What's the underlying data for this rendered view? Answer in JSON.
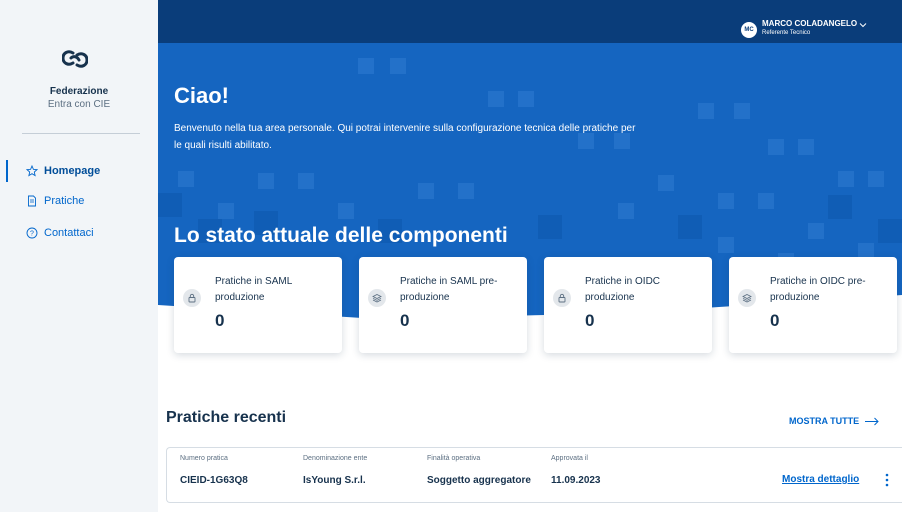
{
  "sidebar": {
    "brand_title": "Federazione",
    "brand_subtitle": "Entra con CIE",
    "items": [
      {
        "label": "Homepage",
        "icon": "star-icon",
        "active": true
      },
      {
        "label": "Pratiche",
        "icon": "document-icon",
        "active": false
      },
      {
        "label": "Contattaci",
        "icon": "help-circle-icon",
        "active": false
      }
    ]
  },
  "header": {
    "avatar_initials": "MC",
    "user_name": "MARCO COLADANGELO",
    "user_role": "Referente Tecnico"
  },
  "hero": {
    "title": "Ciao!",
    "text": "Benvenuto nella tua area personale. Qui potrai intervenire sulla configurazione tecnica delle pratiche per le quali risulti abilitato.",
    "section_title": "Lo stato attuale delle componenti"
  },
  "cards": [
    {
      "label": "Pratiche in SAML produzione",
      "value": "0",
      "icon": "lock-icon"
    },
    {
      "label": "Pratiche in SAML pre-produzione",
      "value": "0",
      "icon": "layers-icon"
    },
    {
      "label": "Pratiche in OIDC produzione",
      "value": "0",
      "icon": "lock-icon"
    },
    {
      "label": "Pratiche in OIDC pre-produzione",
      "value": "0",
      "icon": "layers-icon"
    }
  ],
  "recent": {
    "title": "Pratiche recenti",
    "show_all_label": "MOSTRA TUTTE",
    "columns": [
      "Numero pratica",
      "Denominazione ente",
      "Finalità operativa",
      "Approvata il"
    ],
    "rows": [
      {
        "values": [
          "CIEID-1G63Q8",
          "IsYoung S.r.l.",
          "Soggetto aggregatore",
          "11.09.2023"
        ],
        "detail_label": "Mostra dettaglio"
      }
    ]
  },
  "colors": {
    "primary": "#0066cc",
    "topbar": "#0a3d7a",
    "hero": "#1565c0",
    "sidebar_bg": "#f2f5f8",
    "text_dark": "#17324d"
  }
}
